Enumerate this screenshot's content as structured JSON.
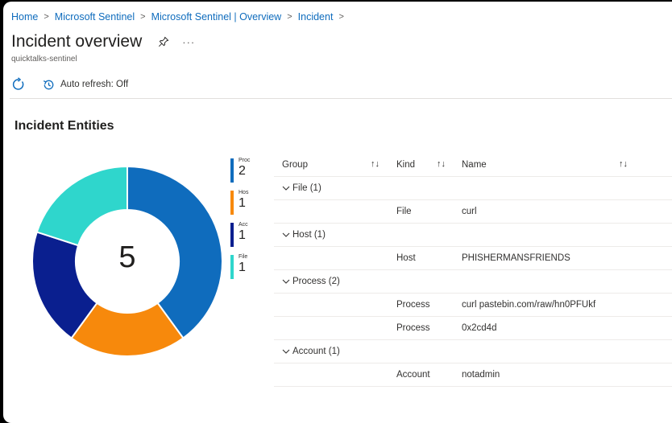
{
  "breadcrumb": [
    "Home",
    "Microsoft Sentinel",
    "Microsoft Sentinel | Overview",
    "Incident"
  ],
  "page": {
    "title": "Incident overview",
    "subtitle": "quicktalks-sentinel"
  },
  "toolbar": {
    "auto_refresh_label": "Auto refresh: Off"
  },
  "panel": {
    "title": "Incident Entities",
    "total": "5"
  },
  "legend": [
    {
      "label": "Proc",
      "value": "2",
      "color": "#0f6cbd"
    },
    {
      "label": "Hos",
      "value": "1",
      "color": "#f7890c"
    },
    {
      "label": "Acc",
      "value": "1",
      "color": "#0a1f8f"
    },
    {
      "label": "File",
      "value": "1",
      "color": "#2fd6cc"
    }
  ],
  "chart_data": {
    "type": "pie",
    "categories": [
      "Process",
      "Host",
      "Account",
      "File"
    ],
    "values": [
      2,
      1,
      1,
      1
    ],
    "colors": [
      "#0f6cbd",
      "#f7890c",
      "#0a1f8f",
      "#2fd6cc"
    ],
    "total": 5
  },
  "table": {
    "headers": {
      "group": "Group",
      "kind": "Kind",
      "name": "Name"
    },
    "groups": [
      {
        "label": "File (1)",
        "rows": [
          {
            "kind": "File",
            "name": "curl"
          }
        ]
      },
      {
        "label": "Host (1)",
        "rows": [
          {
            "kind": "Host",
            "name": "PHISHERMANSFRIENDS"
          }
        ]
      },
      {
        "label": "Process (2)",
        "rows": [
          {
            "kind": "Process",
            "name": "curl pastebin.com/raw/hn0PFUkf"
          },
          {
            "kind": "Process",
            "name": "0x2cd4d"
          }
        ]
      },
      {
        "label": "Account (1)",
        "rows": [
          {
            "kind": "Account",
            "name": "notadmin"
          }
        ]
      }
    ]
  }
}
